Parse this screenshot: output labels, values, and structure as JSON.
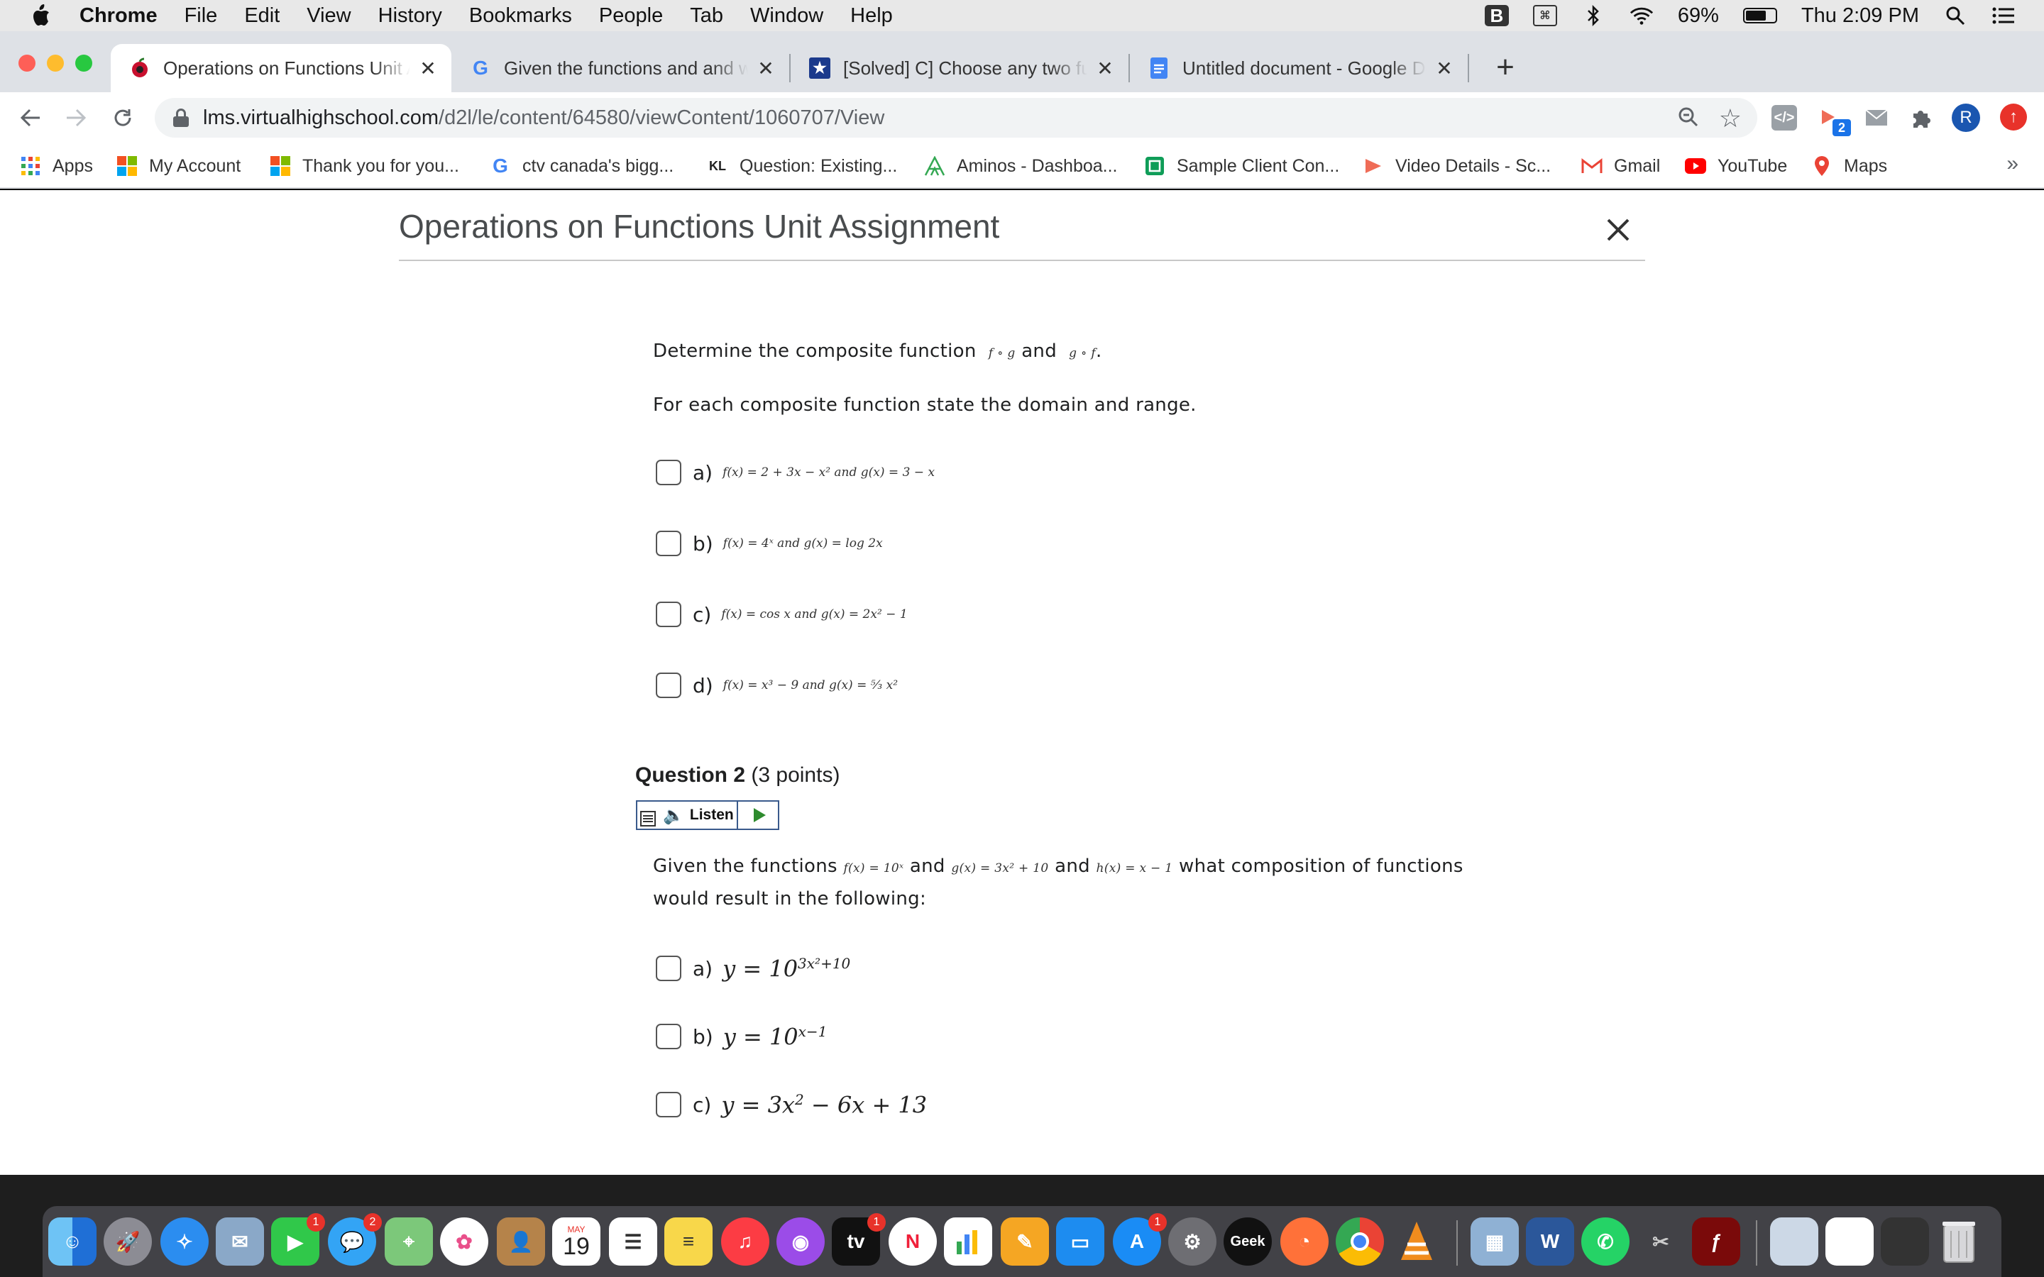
{
  "menubar": {
    "app": "Chrome",
    "items": [
      "File",
      "Edit",
      "View",
      "History",
      "Bookmarks",
      "People",
      "Tab",
      "Window",
      "Help"
    ],
    "battery_percent": "69%",
    "battery_level": 0.69,
    "clock": "Thu 2:09 PM"
  },
  "tabs": [
    {
      "title": "Operations on Functions Unit Assignment",
      "icon": "apple-icon",
      "active": true
    },
    {
      "title": "Given the functions and and what composition",
      "icon": "google-g-icon",
      "active": false
    },
    {
      "title": "[Solved] C] Choose any two functions",
      "icon": "star-shield-icon",
      "active": false
    },
    {
      "title": "Untitled document - Google Docs",
      "icon": "google-docs-icon",
      "active": false
    }
  ],
  "toolbar": {
    "url_host": "lms.virtualhighschool.com",
    "url_path": "/d2l/le/content/64580/viewContent/1060707/View",
    "ext_badge": "2",
    "profile_initial": "R"
  },
  "bookmarks": [
    {
      "label": "Apps",
      "icon": "apps-grid-icon"
    },
    {
      "label": "My Account",
      "icon": "microsoft-icon"
    },
    {
      "label": "Thank you for you...",
      "icon": "microsoft-icon"
    },
    {
      "label": "ctv canada's bigg...",
      "icon": "google-g-icon"
    },
    {
      "label": "Question: Existing...",
      "icon": "kl-icon"
    },
    {
      "label": "Aminos - Dashboa...",
      "icon": "aminos-icon"
    },
    {
      "label": "Sample Client Con...",
      "icon": "doc-icon"
    },
    {
      "label": "Video Details - Sc...",
      "icon": "video-icon"
    },
    {
      "label": "Gmail",
      "icon": "gmail-icon"
    },
    {
      "label": "YouTube",
      "icon": "youtube-icon"
    },
    {
      "label": "Maps",
      "icon": "maps-icon"
    }
  ],
  "page": {
    "title": "Operations on Functions Unit Assignment",
    "q1": {
      "intro_prefix": "Determine the composite function",
      "intro_fog": "f ∘ g",
      "intro_and": "and",
      "intro_gof": "g ∘ f",
      "intro_suffix": ".",
      "instruction": "For each composite function state the domain and range.",
      "options": [
        {
          "letter": "a)",
          "math": "f(x) = 2 + 3x − x² and g(x) = 3 − x"
        },
        {
          "letter": "b)",
          "math": "f(x) = 4ˣ  and  g(x) = log 2x"
        },
        {
          "letter": "c)",
          "math": "f(x) = cos x  and  g(x) = 2x² − 1"
        },
        {
          "letter": "d)",
          "math": "f(x) = x³ − 9  and  g(x) = ⁵⁄₃ x²"
        }
      ]
    },
    "q2": {
      "heading": "Question 2",
      "points": "(3 points)",
      "listen_label": "Listen",
      "text_prefix": "Given the functions",
      "f": "f(x) = 10ˣ",
      "and1": "and",
      "g": "g(x) = 3x² + 10",
      "and2": "and",
      "h": "h(x) = x − 1",
      "text_suffix": "what composition of functions",
      "text_line2": "would result in the following:",
      "options": [
        {
          "letter": "a)",
          "base": "y = 10",
          "exp": "3x²+10",
          "tail": ""
        },
        {
          "letter": "b)",
          "base": "y = 10",
          "exp": "x−1",
          "tail": ""
        },
        {
          "letter": "c)",
          "base": "y = 3x",
          "exp": "2",
          "tail": " − 6x + 13"
        }
      ]
    }
  },
  "dock": {
    "badges": {
      "facetime": "1",
      "messages": "2",
      "appletv": "1",
      "appstore": "1"
    },
    "calendar_month": "MAY",
    "calendar_day": "19"
  }
}
